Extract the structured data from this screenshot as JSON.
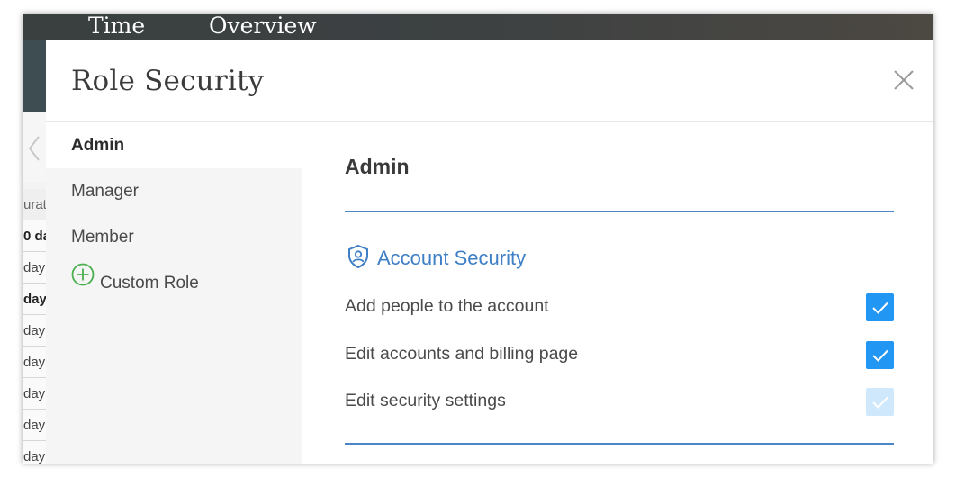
{
  "background": {
    "nav": [
      ".",
      "Time",
      "Overview"
    ],
    "column_cells": [
      {
        "text": "urat",
        "style": "head"
      },
      {
        "text": "0 da",
        "style": "bold"
      },
      {
        "text": "day",
        "style": "normal"
      },
      {
        "text": "day",
        "style": "bold"
      },
      {
        "text": "day",
        "style": "normal"
      },
      {
        "text": "day",
        "style": "normal"
      },
      {
        "text": "day",
        "style": "normal"
      },
      {
        "text": "day",
        "style": "normal"
      },
      {
        "text": "day",
        "style": "normal"
      }
    ]
  },
  "modal": {
    "title": "Role Security",
    "close_icon": "close-icon"
  },
  "roles": {
    "items": [
      {
        "label": "Admin",
        "active": true
      },
      {
        "label": "Manager",
        "active": false
      },
      {
        "label": "Member",
        "active": false
      }
    ],
    "custom": {
      "label": "Custom Role",
      "icon": "plus-circle-icon"
    }
  },
  "content": {
    "section_title": "Admin",
    "group": {
      "label": "Account Security",
      "icon": "shield-user-icon"
    },
    "permissions": [
      {
        "label": "Add people to the account",
        "checked": true,
        "disabled": false
      },
      {
        "label": "Edit accounts and billing page",
        "checked": true,
        "disabled": false
      },
      {
        "label": "Edit security settings",
        "checked": true,
        "disabled": true
      }
    ]
  },
  "colors": {
    "accent_blue": "#3e7fc6",
    "checkbox_blue": "#2196f3",
    "checkbox_disabled": "#cfe8fb",
    "plus_green": "#4caf50"
  }
}
